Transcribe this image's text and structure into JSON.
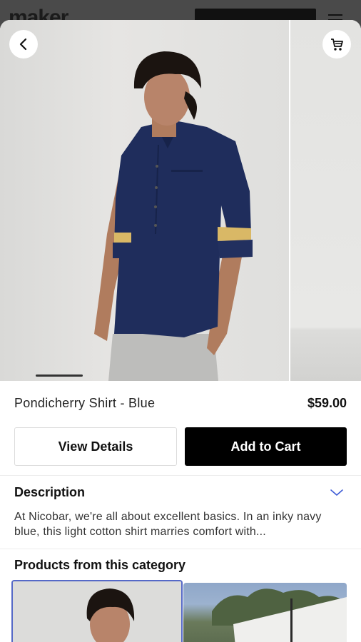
{
  "background_page": {
    "logo": "maker"
  },
  "gallery": {
    "main_image": "Model wearing Pondicherry Shirt in blue, standing against a light wall",
    "next_image": "Same shirt shown against a light wall",
    "slide_index": 1
  },
  "icons": {
    "back": "chevron-left-icon",
    "cart": "shopping-cart-icon",
    "expand": "chevron-down-icon"
  },
  "product": {
    "name": "Pondicherry Shirt - Blue",
    "price": "$59.00"
  },
  "actions": {
    "view_details": "View Details",
    "add_to_cart": "Add to Cart"
  },
  "description": {
    "heading": "Description",
    "text": "At Nicobar, we're all about excellent basics. In an inky navy blue, this light cotton shirt marries comfort with..."
  },
  "category": {
    "heading": "Products from this category",
    "items": [
      {
        "image": "Model in blue shirt"
      },
      {
        "image": "White garment outdoors with trees and sky"
      }
    ]
  },
  "colors": {
    "accent": "#5569c7",
    "primary_button": "#000000",
    "shirt": "#1f2d5c"
  }
}
